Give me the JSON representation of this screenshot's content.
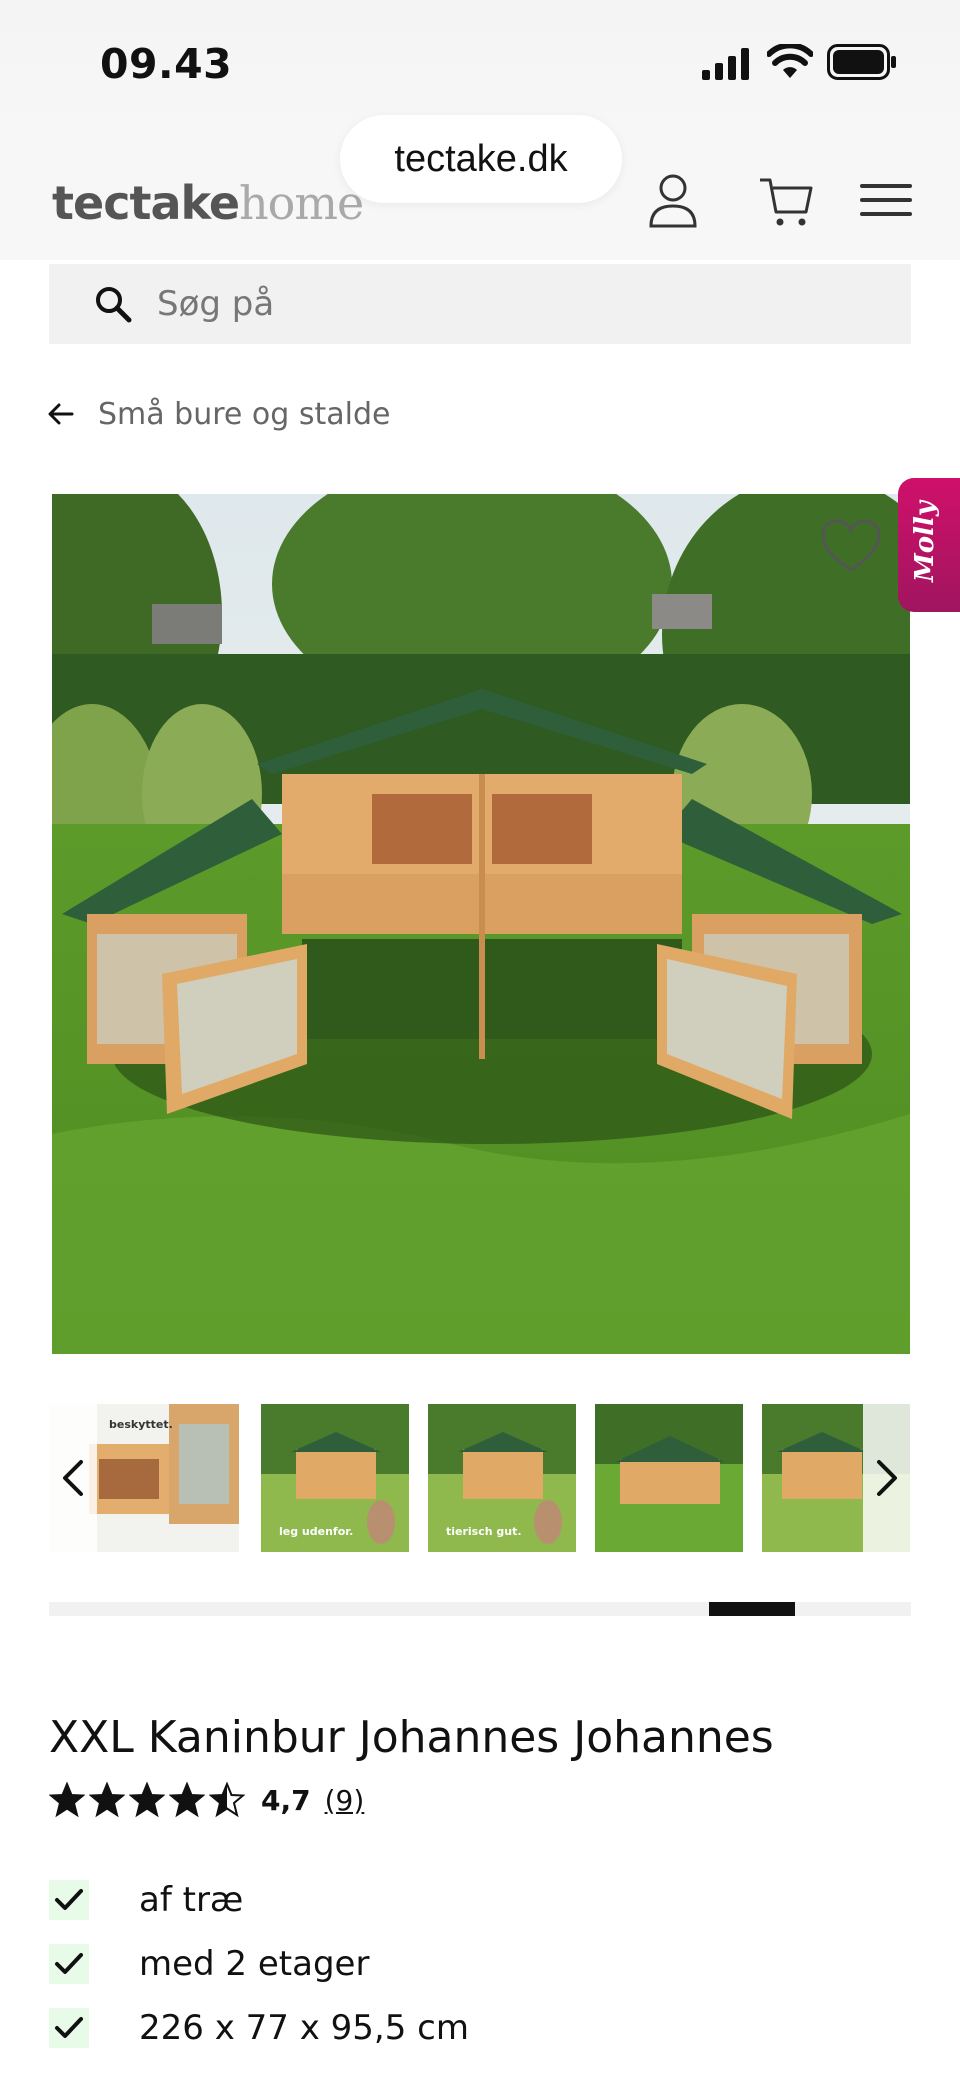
{
  "status_bar": {
    "time": "09.43"
  },
  "browser": {
    "url": "tectake.dk"
  },
  "header": {
    "logo_part1": "tectake",
    "logo_part2": "home"
  },
  "search": {
    "placeholder": "Søg på"
  },
  "breadcrumb": {
    "label": "Små bure og stalde"
  },
  "gallery": {
    "thumbnails": [
      {
        "caption": "beskyttet."
      },
      {
        "caption": "leg udenfor."
      },
      {
        "caption": "tierisch gut."
      },
      {
        "caption": ""
      },
      {
        "caption": ""
      }
    ],
    "scroll_position_fraction": 0.85
  },
  "chat_widget": {
    "label": "Molly",
    "color": "#c8126a"
  },
  "product": {
    "title": "XXL Kaninbur Johannes Johannes",
    "rating_value": "4,7",
    "rating_stars": 4.5,
    "review_count": "(9)",
    "features": [
      "af træ",
      "med 2 etager",
      "226 x 77 x 95,5 cm"
    ]
  },
  "colors": {
    "accent": "#111111",
    "check_bg": "#e8fbe9",
    "logo_dark": "#555555",
    "logo_light": "#a9a9a9"
  }
}
